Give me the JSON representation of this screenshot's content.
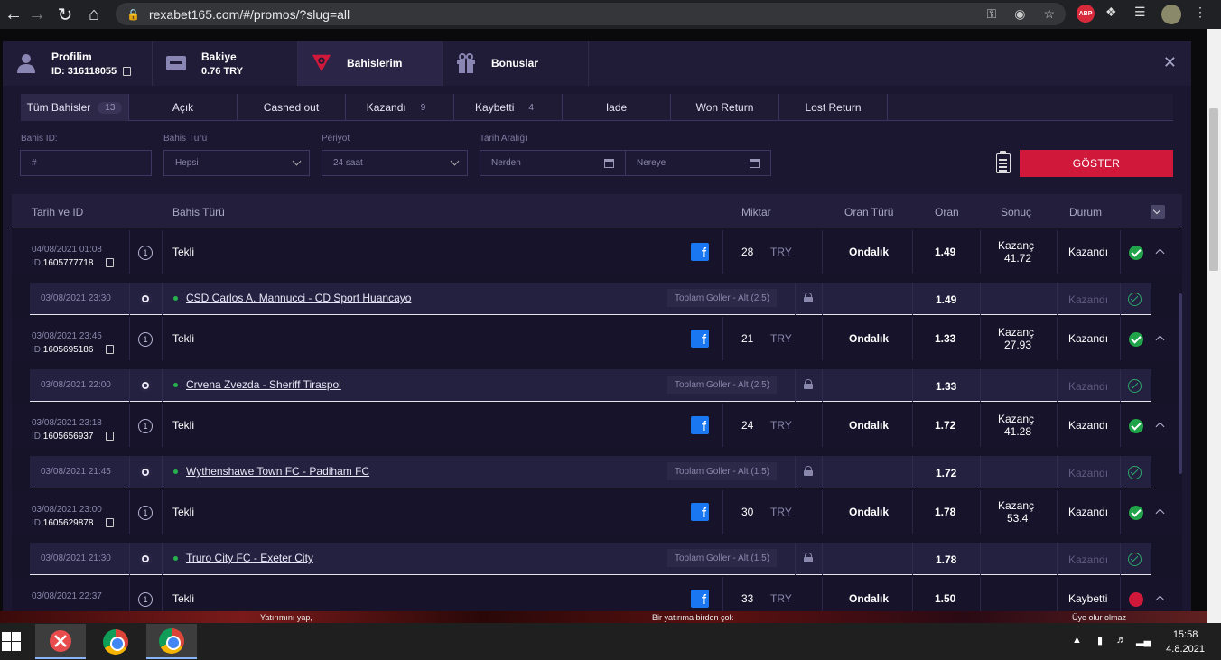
{
  "browser": {
    "url": "rexabet165.com/#/promos/?slug=all",
    "abp_label": "ABP"
  },
  "header_tabs": [
    {
      "title": "Profilim",
      "sub": "ID: 316118055",
      "icon": "user-icon"
    },
    {
      "title": "Bakiye",
      "sub": "0.76 TRY",
      "icon": "wallet-icon"
    },
    {
      "title": "Bahislerim",
      "sub": "",
      "icon": "bets-logo-icon"
    },
    {
      "title": "Bonuslar",
      "sub": "",
      "icon": "gift-icon"
    }
  ],
  "filter_tabs": [
    {
      "label": "Tüm Bahisler",
      "count": "13"
    },
    {
      "label": "Açık",
      "count": ""
    },
    {
      "label": "Cashed out",
      "count": ""
    },
    {
      "label": "Kazandı",
      "count": "9"
    },
    {
      "label": "Kaybetti",
      "count": "4"
    },
    {
      "label": "Iade",
      "count": ""
    },
    {
      "label": "Won Return",
      "count": ""
    },
    {
      "label": "Lost Return",
      "count": ""
    }
  ],
  "form": {
    "bet_id_label": "Bahis ID:",
    "bet_id_placeholder": "#",
    "bet_type_label": "Bahis Türü",
    "bet_type_value": "Hepsi",
    "period_label": "Periyot",
    "period_value": "24 saat",
    "date_range_label": "Tarih Aralığı",
    "from_placeholder": "Nerden",
    "to_placeholder": "Nereye",
    "show_button": "GÖSTER"
  },
  "table": {
    "headers": [
      "Tarih ve ID",
      "Bahis Türü",
      "Miktar",
      "Oran Türü",
      "Oran",
      "Sonuç",
      "Durum"
    ]
  },
  "bets": [
    {
      "date": "04/08/2021 01:08",
      "id_label": "ID:",
      "id": "1605777718",
      "num": "1",
      "type": "Tekli",
      "fb": "f",
      "amount": "28",
      "currency": "TRY",
      "odds_type": "Ondalık",
      "odds": "1.49",
      "result_label": "Kazanç",
      "result_value": "41.72",
      "status": "Kazandı",
      "sel": {
        "date": "03/08/2021 23:30",
        "match": "CSD Carlos A. Mannucci - CD Sport Huancayo",
        "market": "Toplam Goller - Alt (2.5)",
        "odds": "1.49",
        "status": "Kazandı"
      }
    },
    {
      "date": "03/08/2021 23:45",
      "id_label": "ID:",
      "id": "1605695186",
      "num": "1",
      "type": "Tekli",
      "fb": "f",
      "amount": "21",
      "currency": "TRY",
      "odds_type": "Ondalık",
      "odds": "1.33",
      "result_label": "Kazanç",
      "result_value": "27.93",
      "status": "Kazandı",
      "sel": {
        "date": "03/08/2021 22:00",
        "match": "Crvena Zvezda - Sheriff Tiraspol",
        "market": "Toplam Goller - Alt (2.5)",
        "odds": "1.33",
        "status": "Kazandı"
      }
    },
    {
      "date": "03/08/2021 23:18",
      "id_label": "ID:",
      "id": "1605656937",
      "num": "1",
      "type": "Tekli",
      "fb": "f",
      "amount": "24",
      "currency": "TRY",
      "odds_type": "Ondalık",
      "odds": "1.72",
      "result_label": "Kazanç",
      "result_value": "41.28",
      "status": "Kazandı",
      "sel": {
        "date": "03/08/2021 21:45",
        "match": "Wythenshawe Town FC - Padiham FC",
        "market": "Toplam Goller - Alt (1.5)",
        "odds": "1.72",
        "status": "Kazandı"
      }
    },
    {
      "date": "03/08/2021 23:00",
      "id_label": "ID:",
      "id": "1605629878",
      "num": "1",
      "type": "Tekli",
      "fb": "f",
      "amount": "30",
      "currency": "TRY",
      "odds_type": "Ondalık",
      "odds": "1.78",
      "result_label": "Kazanç",
      "result_value": "53.4",
      "status": "Kazandı",
      "sel": {
        "date": "03/08/2021 21:30",
        "match": "Truro City FC - Exeter City",
        "market": "Toplam Goller - Alt (1.5)",
        "odds": "1.78",
        "status": "Kazandı"
      }
    },
    {
      "date": "03/08/2021 22:37",
      "id_label": "",
      "id": "",
      "num": "1",
      "type": "Tekli",
      "fb": "f",
      "amount": "33",
      "currency": "TRY",
      "odds_type": "Ondalık",
      "odds": "1.50",
      "result_label": "",
      "result_value": "",
      "status": "Kaybetti"
    }
  ],
  "background_strip": [
    "Yatırımını yap,",
    "Bir yatırıma birden çok",
    "Üye olur olmaz"
  ],
  "taskbar": {
    "time": "15:58",
    "date": "4.8.2021"
  },
  "colors": {
    "accent": "#d0193a",
    "win": "#21a34a",
    "modal_bg": "#1b1730"
  }
}
